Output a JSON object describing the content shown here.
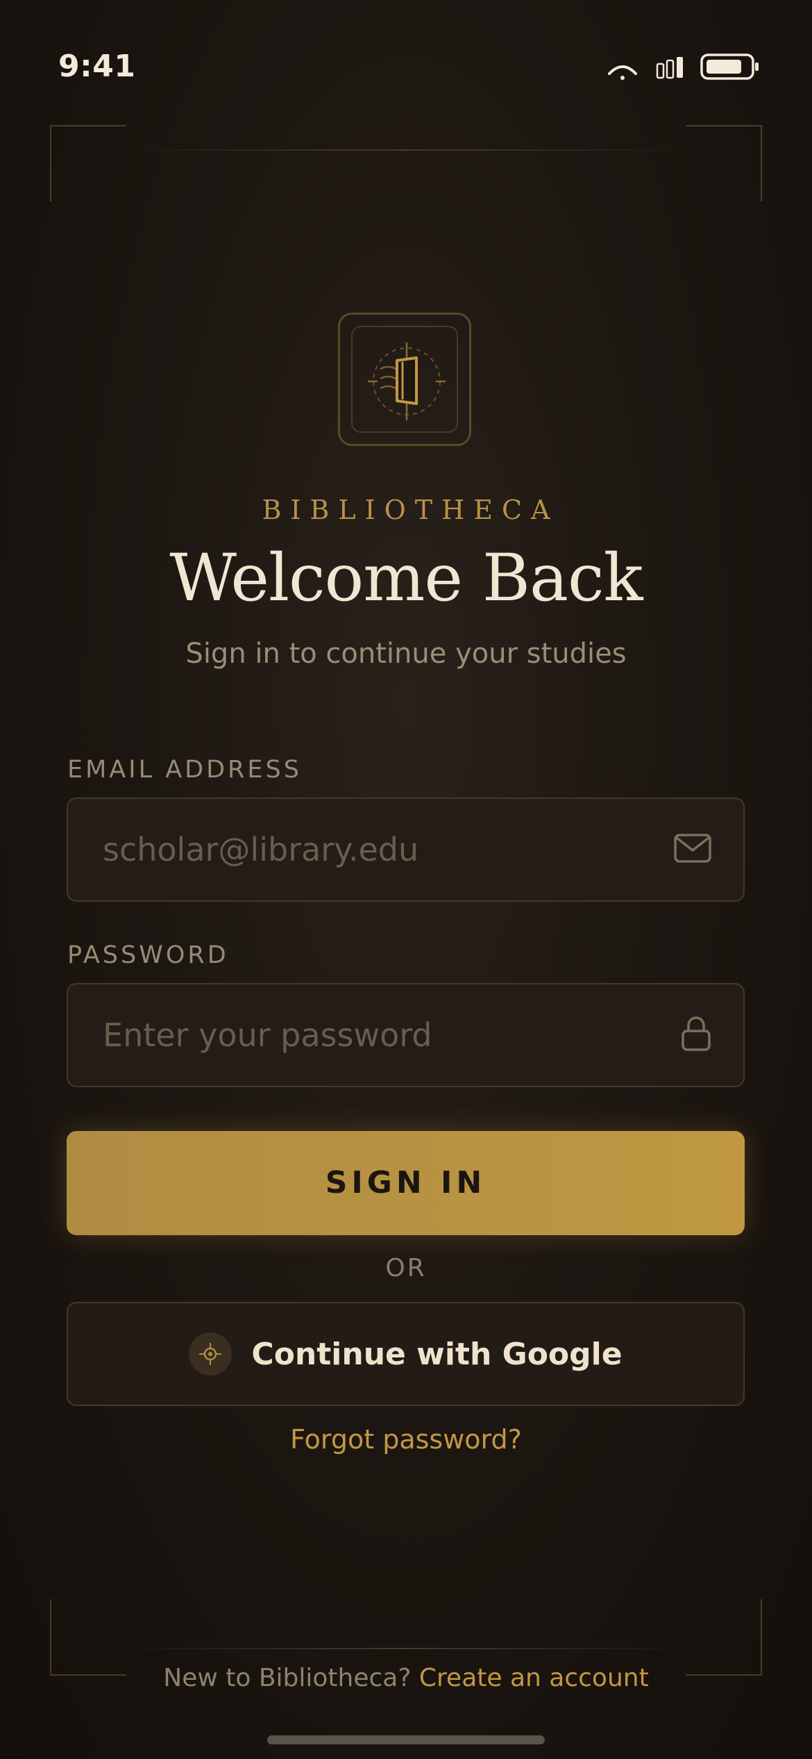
{
  "status_bar": {
    "time": "9:41",
    "icons": [
      "wifi-icon",
      "signal-icon",
      "battery-icon"
    ]
  },
  "logo": {
    "icon": "book-emblem-icon"
  },
  "header": {
    "brand": "BIBLIOTHECA",
    "title": "Welcome Back",
    "subtitle": "Sign in to continue your studies"
  },
  "form": {
    "email": {
      "label": "EMAIL ADDRESS",
      "placeholder": "scholar@library.edu",
      "value": "",
      "icon": "mail-icon"
    },
    "password": {
      "label": "PASSWORD",
      "placeholder": "Enter your password",
      "value": "",
      "icon": "lock-icon"
    },
    "submit_label": "SIGN IN",
    "divider": "OR",
    "google_label": "Continue with Google",
    "google_icon": "google-compass-icon",
    "forgot_label": "Forgot password?"
  },
  "footer": {
    "prompt": "New to Bibliotheca?",
    "link": "Create an account"
  },
  "colors": {
    "accent": "#c39743",
    "button": "#bb9541",
    "background": "#1d1712",
    "text": "#efe3cc"
  }
}
